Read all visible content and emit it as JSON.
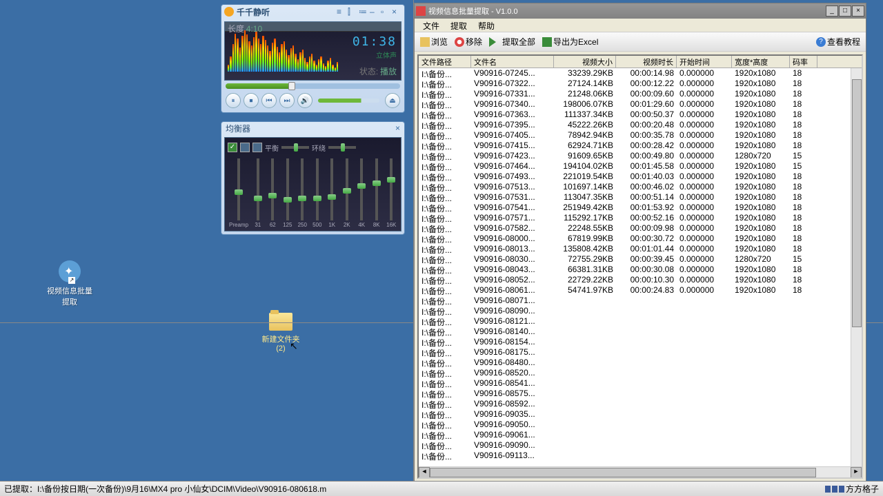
{
  "desktop": {
    "icon_label": "视频信息批量\n提取",
    "folder_label": "新建文件夹\n(2)"
  },
  "player": {
    "title": "千千静听",
    "length_label": "长度",
    "length_value": "4:10",
    "time": "01:38",
    "stereo": "立体声",
    "status_label": "状态:",
    "status_value": "播放"
  },
  "eq": {
    "title": "均衡器",
    "balance": "平衡",
    "surround": "环绕",
    "bands": [
      "Preamp",
      "31",
      "62",
      "125",
      "250",
      "500",
      "1K",
      "2K",
      "4K",
      "8K",
      "16K"
    ],
    "positions": [
      50,
      60,
      55,
      62,
      60,
      60,
      58,
      48,
      40,
      35,
      30
    ]
  },
  "vx": {
    "title": "视频信息批量提取 - V1.0.0",
    "menu": [
      "文件",
      "提取",
      "帮助"
    ],
    "tb_browse": "浏览",
    "tb_remove": "移除",
    "tb_extract": "提取全部",
    "tb_excel": "导出为Excel",
    "tb_help": "查看教程",
    "columns": [
      "文件路径",
      "文件名",
      "视频大小",
      "视频时长",
      "开始时间",
      "宽度*高度",
      "码率"
    ],
    "rows": [
      {
        "p": "I:\\备份...",
        "f": "V90916-07245...",
        "s": "33239.29KB",
        "d": "00:00:14.98",
        "t": "0.000000",
        "wh": "1920x1080",
        "b": "18"
      },
      {
        "p": "I:\\备份...",
        "f": "V90916-07322...",
        "s": "27124.14KB",
        "d": "00:00:12.22",
        "t": "0.000000",
        "wh": "1920x1080",
        "b": "18"
      },
      {
        "p": "I:\\备份...",
        "f": "V90916-07331...",
        "s": "21248.06KB",
        "d": "00:00:09.60",
        "t": "0.000000",
        "wh": "1920x1080",
        "b": "18"
      },
      {
        "p": "I:\\备份...",
        "f": "V90916-07340...",
        "s": "198006.07KB",
        "d": "00:01:29.60",
        "t": "0.000000",
        "wh": "1920x1080",
        "b": "18"
      },
      {
        "p": "I:\\备份...",
        "f": "V90916-07363...",
        "s": "111337.34KB",
        "d": "00:00:50.37",
        "t": "0.000000",
        "wh": "1920x1080",
        "b": "18"
      },
      {
        "p": "I:\\备份...",
        "f": "V90916-07395...",
        "s": "45222.26KB",
        "d": "00:00:20.48",
        "t": "0.000000",
        "wh": "1920x1080",
        "b": "18"
      },
      {
        "p": "I:\\备份...",
        "f": "V90916-07405...",
        "s": "78942.94KB",
        "d": "00:00:35.78",
        "t": "0.000000",
        "wh": "1920x1080",
        "b": "18"
      },
      {
        "p": "I:\\备份...",
        "f": "V90916-07415...",
        "s": "62924.71KB",
        "d": "00:00:28.42",
        "t": "0.000000",
        "wh": "1920x1080",
        "b": "18"
      },
      {
        "p": "I:\\备份...",
        "f": "V90916-07423...",
        "s": "91609.65KB",
        "d": "00:00:49.80",
        "t": "0.000000",
        "wh": "1280x720",
        "b": "15"
      },
      {
        "p": "I:\\备份...",
        "f": "V90916-07464...",
        "s": "194104.02KB",
        "d": "00:01:45.58",
        "t": "0.000000",
        "wh": "1920x1080",
        "b": "15"
      },
      {
        "p": "I:\\备份...",
        "f": "V90916-07493...",
        "s": "221019.54KB",
        "d": "00:01:40.03",
        "t": "0.000000",
        "wh": "1920x1080",
        "b": "18"
      },
      {
        "p": "I:\\备份...",
        "f": "V90916-07513...",
        "s": "101697.14KB",
        "d": "00:00:46.02",
        "t": "0.000000",
        "wh": "1920x1080",
        "b": "18"
      },
      {
        "p": "I:\\备份...",
        "f": "V90916-07531...",
        "s": "113047.35KB",
        "d": "00:00:51.14",
        "t": "0.000000",
        "wh": "1920x1080",
        "b": "18"
      },
      {
        "p": "I:\\备份...",
        "f": "V90916-07541...",
        "s": "251949.42KB",
        "d": "00:01:53.92",
        "t": "0.000000",
        "wh": "1920x1080",
        "b": "18"
      },
      {
        "p": "I:\\备份...",
        "f": "V90916-07571...",
        "s": "115292.17KB",
        "d": "00:00:52.16",
        "t": "0.000000",
        "wh": "1920x1080",
        "b": "18"
      },
      {
        "p": "I:\\备份...",
        "f": "V90916-07582...",
        "s": "22248.55KB",
        "d": "00:00:09.98",
        "t": "0.000000",
        "wh": "1920x1080",
        "b": "18"
      },
      {
        "p": "I:\\备份...",
        "f": "V90916-08000...",
        "s": "67819.99KB",
        "d": "00:00:30.72",
        "t": "0.000000",
        "wh": "1920x1080",
        "b": "18"
      },
      {
        "p": "I:\\备份...",
        "f": "V90916-08013...",
        "s": "135808.42KB",
        "d": "00:01:01.44",
        "t": "0.000000",
        "wh": "1920x1080",
        "b": "18"
      },
      {
        "p": "I:\\备份...",
        "f": "V90916-08030...",
        "s": "72755.29KB",
        "d": "00:00:39.45",
        "t": "0.000000",
        "wh": "1280x720",
        "b": "15"
      },
      {
        "p": "I:\\备份...",
        "f": "V90916-08043...",
        "s": "66381.31KB",
        "d": "00:00:30.08",
        "t": "0.000000",
        "wh": "1920x1080",
        "b": "18"
      },
      {
        "p": "I:\\备份...",
        "f": "V90916-08052...",
        "s": "22729.22KB",
        "d": "00:00:10.30",
        "t": "0.000000",
        "wh": "1920x1080",
        "b": "18"
      },
      {
        "p": "I:\\备份...",
        "f": "V90916-08061...",
        "s": "54741.97KB",
        "d": "00:00:24.83",
        "t": "0.000000",
        "wh": "1920x1080",
        "b": "18"
      },
      {
        "p": "I:\\备份...",
        "f": "V90916-08071...",
        "s": "",
        "d": "",
        "t": "",
        "wh": "",
        "b": ""
      },
      {
        "p": "I:\\备份...",
        "f": "V90916-08090...",
        "s": "",
        "d": "",
        "t": "",
        "wh": "",
        "b": ""
      },
      {
        "p": "I:\\备份...",
        "f": "V90916-08121...",
        "s": "",
        "d": "",
        "t": "",
        "wh": "",
        "b": ""
      },
      {
        "p": "I:\\备份...",
        "f": "V90916-08140...",
        "s": "",
        "d": "",
        "t": "",
        "wh": "",
        "b": ""
      },
      {
        "p": "I:\\备份...",
        "f": "V90916-08154...",
        "s": "",
        "d": "",
        "t": "",
        "wh": "",
        "b": ""
      },
      {
        "p": "I:\\备份...",
        "f": "V90916-08175...",
        "s": "",
        "d": "",
        "t": "",
        "wh": "",
        "b": ""
      },
      {
        "p": "I:\\备份...",
        "f": "V90916-08480...",
        "s": "",
        "d": "",
        "t": "",
        "wh": "",
        "b": ""
      },
      {
        "p": "I:\\备份...",
        "f": "V90916-08520...",
        "s": "",
        "d": "",
        "t": "",
        "wh": "",
        "b": ""
      },
      {
        "p": "I:\\备份...",
        "f": "V90916-08541...",
        "s": "",
        "d": "",
        "t": "",
        "wh": "",
        "b": ""
      },
      {
        "p": "I:\\备份...",
        "f": "V90916-08575...",
        "s": "",
        "d": "",
        "t": "",
        "wh": "",
        "b": ""
      },
      {
        "p": "I:\\备份...",
        "f": "V90916-08592...",
        "s": "",
        "d": "",
        "t": "",
        "wh": "",
        "b": ""
      },
      {
        "p": "I:\\备份...",
        "f": "V90916-09035...",
        "s": "",
        "d": "",
        "t": "",
        "wh": "",
        "b": ""
      },
      {
        "p": "I:\\备份...",
        "f": "V90916-09050...",
        "s": "",
        "d": "",
        "t": "",
        "wh": "",
        "b": ""
      },
      {
        "p": "I:\\备份...",
        "f": "V90916-09061...",
        "s": "",
        "d": "",
        "t": "",
        "wh": "",
        "b": ""
      },
      {
        "p": "I:\\备份...",
        "f": "V90916-09090...",
        "s": "",
        "d": "",
        "t": "",
        "wh": "",
        "b": ""
      },
      {
        "p": "I:\\备份...",
        "f": "V90916-09113...",
        "s": "",
        "d": "",
        "t": "",
        "wh": "",
        "b": ""
      }
    ]
  },
  "taskbar": {
    "status": "已提取：I:\\备份按日期(一次备份)\\9月16\\MX4 pro 小仙女\\DCIM\\Video\\V90916-080618.m",
    "tray_text": "方方格子"
  },
  "spectrum_heights": [
    10,
    22,
    40,
    55,
    48,
    35,
    52,
    60,
    54,
    44,
    38,
    50,
    58,
    48,
    40,
    52,
    46,
    38,
    30,
    42,
    48,
    36,
    28,
    40,
    44,
    32,
    24,
    34,
    38,
    26,
    18,
    28,
    32,
    20,
    14,
    22,
    26,
    16,
    10,
    18,
    22,
    12,
    8,
    16,
    20,
    10,
    6,
    14
  ]
}
